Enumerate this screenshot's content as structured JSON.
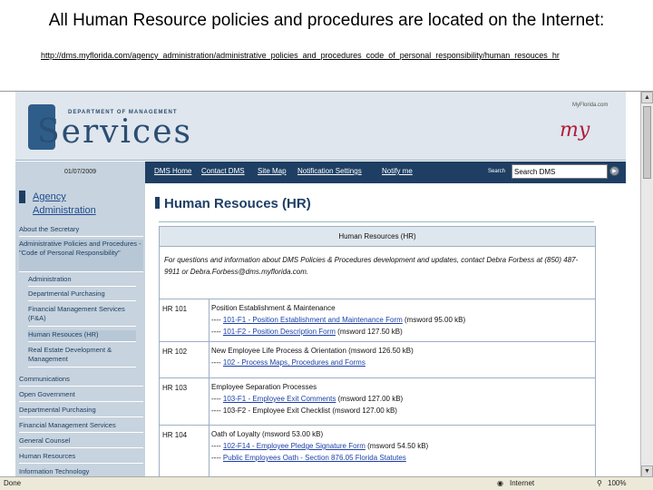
{
  "slide": {
    "title": "All Human Resource policies and procedures are located on the Internet:",
    "url": "http://dms.myflorida.com/agency_administration/administrative_policies_and_procedures_code_of_personal_responsibility/human_resouces_hr"
  },
  "banner": {
    "dept_text": "DEPARTMENT OF MANAGEMENT",
    "services_text": "Services",
    "myflorida_small": "MyFlorida.com",
    "myflorida": "my"
  },
  "navbar": {
    "date": "01/07/2009",
    "links": [
      "DMS Home",
      "Contact DMS",
      "Site Map",
      "Notification Settings",
      "Notify me"
    ],
    "search_label": "Search",
    "search_value": "Search DMS",
    "go_icon": "arrow-right-icon"
  },
  "sidebar": {
    "section_title_line1": "Agency",
    "section_title_line2": "Administration",
    "items": [
      "About the Secretary",
      "Administrative Policies and Procedures - \"Code of Personal Responsibility\"",
      "Administration",
      "Departmental Purchasing",
      "Financial Management Services (F&A)",
      "Human Resouces (HR)",
      "Real Estate Development & Management",
      "Communications",
      "Open Government",
      "Departmental Purchasing",
      "Financial Management Services",
      "General Counsel",
      "Human Resources",
      "Information Technology"
    ]
  },
  "content": {
    "heading": "Human Resouces (HR)",
    "table_header": "Human Resources (HR)",
    "intro": "For questions and information about DMS Policies & Procedures development and updates, contact Debra Forbess at (850) 487-9911 or Debra.Forbess@dms.myflorida.com.",
    "rows": [
      {
        "code": "HR 101",
        "title": "Position Establishment & Maintenance",
        "lines": [
          {
            "prefix": "---- ",
            "link": "101-F1 - Position Establishment and Maintenance Form",
            "suffix": " (msword 95.00 kB)"
          },
          {
            "prefix": "---- ",
            "link": "101-F2 - Position Description Form",
            "suffix": " (msword 127.50 kB)"
          }
        ]
      },
      {
        "code": "HR 102",
        "title": "New Employee Life Process & Orientation (msword 126.50 kB)",
        "lines": [
          {
            "prefix": "---- ",
            "link": "102 - Process Maps, Procedures and Forms",
            "suffix": ""
          }
        ]
      },
      {
        "code": "HR 103",
        "title": "Employee Separation Processes",
        "lines": [
          {
            "prefix": "---- ",
            "link": "103-F1 - Employee Exit Comments",
            "suffix": " (msword 127.00 kB)"
          },
          {
            "prefix": "---- ",
            "link": "",
            "suffix": "103-F2 - Employee Exit Checklist (msword 127.00 kB)"
          }
        ]
      },
      {
        "code": "HR 104",
        "title": "Oath of Loyalty (msword 53.00 kB)",
        "lines": [
          {
            "prefix": "---- ",
            "link": "102-F14 - Employee Pledge Signature Form",
            "suffix": " (msword 54.50 kB)"
          },
          {
            "prefix": "---- ",
            "link": "Public Employees Oath - Section 876.05 Florida Statutes",
            "suffix": ""
          }
        ]
      }
    ]
  },
  "statusbar": {
    "left": "Done",
    "zone": "Internet",
    "zoom": "100%"
  }
}
